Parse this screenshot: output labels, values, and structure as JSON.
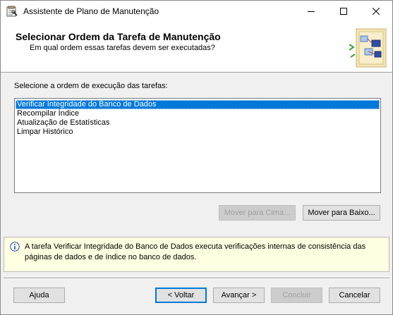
{
  "window": {
    "title": "Assistente de Plano de Manutenção",
    "icon": "maintenance-wizard-icon"
  },
  "header": {
    "title": "Selecionar Ordem da Tarefa de Manutenção",
    "subtitle": "Em qual ordem essas tarefas devem ser executadas?"
  },
  "task_list": {
    "label": "Selecione a ordem de execução das tarefas:",
    "items": [
      {
        "label": "Verificar Integridade do Banco de Dados",
        "selected": true
      },
      {
        "label": "Recompilar Índice",
        "selected": false
      },
      {
        "label": "Atualização de Estatísticas",
        "selected": false
      },
      {
        "label": "Limpar Histórico",
        "selected": false
      }
    ]
  },
  "move_buttons": {
    "up_label": "Mover para Cima...",
    "up_enabled": false,
    "down_label": "Mover para Baixo...",
    "down_enabled": true
  },
  "info": {
    "icon": "info-icon",
    "text": "A tarefa Verificar Integridade do Banco de Dados executa verificações internas de consistência das páginas de dados e de índice no banco de dados."
  },
  "footer": {
    "help_label": "Ajuda",
    "back_label": "< Voltar",
    "next_label": "Avançar >",
    "finish_label": "Concluir",
    "finish_enabled": false,
    "cancel_label": "Cancelar"
  },
  "colors": {
    "selection": "#0078d7",
    "info_background": "#ffffe1",
    "dialog_background": "#f0f0f0"
  }
}
